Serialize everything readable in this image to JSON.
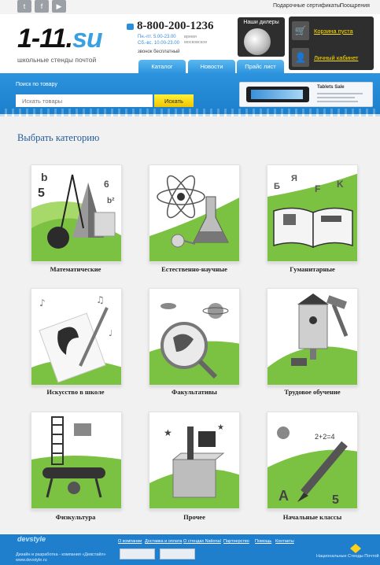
{
  "topbar": {
    "social": [
      {
        "name": "twitter-icon",
        "glyph": "t"
      },
      {
        "name": "facebook-icon",
        "glyph": "f"
      },
      {
        "name": "youtube-icon",
        "glyph": "▶"
      }
    ],
    "links": [
      "Подарочные сертификаты",
      "Поощрения"
    ]
  },
  "header": {
    "logo": "1-11.",
    "logo_su": "su",
    "tagline": "школьные стенды почтой",
    "phone": "8-800-200-1236",
    "hours_weekday": "Пн.-пт. 5.00-23.00",
    "hours_weekend": "Сб.-вс. 10.00-23.00",
    "hours_note": "время московское",
    "free_call": "звонок бесплатный",
    "dealers": "Наши дилеры",
    "cart": "Корзина пуста",
    "cabinet": "Личный кабинет"
  },
  "tabs": [
    "Каталог",
    "Новости",
    "Прайс лист"
  ],
  "search": {
    "label": "Поиск по товару",
    "placeholder": "Искать товары",
    "button": "Искать"
  },
  "promo": {
    "title": "Tablets Sale"
  },
  "main": {
    "title": "Выбрать категорию",
    "categories": [
      {
        "label": "Математические",
        "icon": "geometry-icon"
      },
      {
        "label": "Естественно-научные",
        "icon": "science-icon"
      },
      {
        "label": "Гуманитарные",
        "icon": "book-icon"
      },
      {
        "label": "Искусство в школе",
        "icon": "art-icon"
      },
      {
        "label": "Факультативы",
        "icon": "magnifier-icon"
      },
      {
        "label": "Трудовое обучение",
        "icon": "tools-icon"
      },
      {
        "label": "Физкультура",
        "icon": "gym-icon"
      },
      {
        "label": "Прочее",
        "icon": "box-icon"
      },
      {
        "label": "Начальные классы",
        "icon": "pencil-icon"
      }
    ]
  },
  "footer": {
    "logo": "devstyle",
    "design": "Дизайн и разработка - компания «Девстайл»",
    "design_site": "www.devstyle.ru",
    "nav": [
      "О компании",
      "Доставка и оплата",
      "О стендах National",
      "Партнерство",
      "Помощь",
      "Контакты"
    ],
    "brand": "Национальные Стенды Почтой"
  },
  "colors": {
    "accent_blue": "#2b92dc",
    "green": "#7cc242",
    "yellow": "#f2c400"
  }
}
